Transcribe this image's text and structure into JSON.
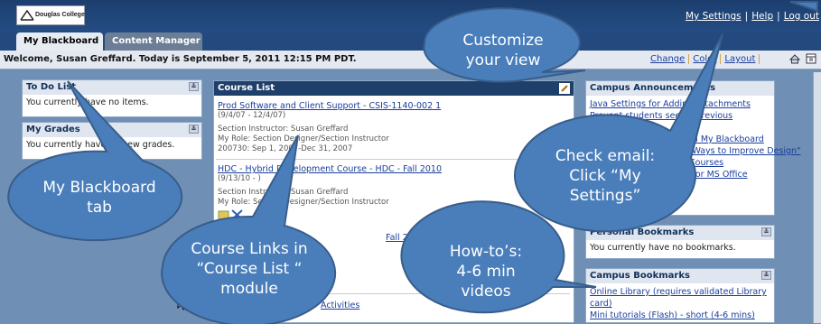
{
  "header": {
    "logo_text": "Douglas College",
    "links": [
      "My Settings",
      "Help",
      "Log out"
    ]
  },
  "tabs": [
    {
      "label": "My Blackboard",
      "active": true
    },
    {
      "label": "Content Manager",
      "active": false
    }
  ],
  "welcome": {
    "message": "Welcome, Susan Greffard. Today is September 5, 2011 12:15 PM PDT.",
    "links": [
      "Change",
      "Color",
      "Layout"
    ]
  },
  "left": {
    "todo": {
      "title": "To Do List",
      "body": "You currently have no items."
    },
    "grades": {
      "title": "My Grades",
      "body": "You currently have no new grades."
    }
  },
  "course_list": {
    "title": "Course List",
    "courses": [
      {
        "title": "Prod Software and Client Support - CSIS-1140-002 1",
        "dates": "(9/4/07 - 12/4/07)",
        "instructor": "Section Instructor: Susan Greffard",
        "role": "My Role: Section Designer/Section Instructor",
        "extra": "200730: Sep 1, 2007-Dec 31, 2007"
      },
      {
        "title": "HDC - Hybrid Development Course - HDC - Fall 2010",
        "dates": "(9/13/10 - )",
        "instructor": "Section Instructor: Susan Greffard",
        "role": "My Role: Section Designer/Section Instructor"
      },
      {
        "title": "Fall 2010) S. Greffard"
      },
      {
        "title": "Activities"
      }
    ],
    "partial_text": "ctor"
  },
  "right": {
    "announcements": {
      "title": "Campus Announcements",
      "links": [
        "Java Settings for Adding Attachments",
        "Prevent students seeing Previous Course Materials",
        "Courses in My Blackboard",
        "\"Ten Ways to Improve Design\"",
        "Courses",
        "Add-in for MS Office"
      ]
    },
    "personal_bookmarks": {
      "title": "Personal Bookmarks",
      "body": "You currently have no bookmarks."
    },
    "campus_bookmarks": {
      "title": "Campus Bookmarks",
      "links": [
        "Online Library (requires validated Library card)",
        "Mini tutorials (Flash) - short (4-6 mins)"
      ]
    }
  },
  "callouts": {
    "customize": [
      "Customize",
      "your view"
    ],
    "check_email": [
      "Check email:",
      "Click “My",
      "Settings”"
    ],
    "my_blackboard": [
      "My Blackboard",
      "tab"
    ],
    "course_links": [
      "Course Links in",
      "“Course List “",
      "module"
    ],
    "howtos": [
      "How-to’s:",
      "4-6 min",
      "videos"
    ]
  },
  "colors": {
    "callout_fill": "#4a7ebb",
    "callout_stroke": "#385d8a",
    "header_bg": "#1c3e6e",
    "link": "#1a3e9c"
  }
}
